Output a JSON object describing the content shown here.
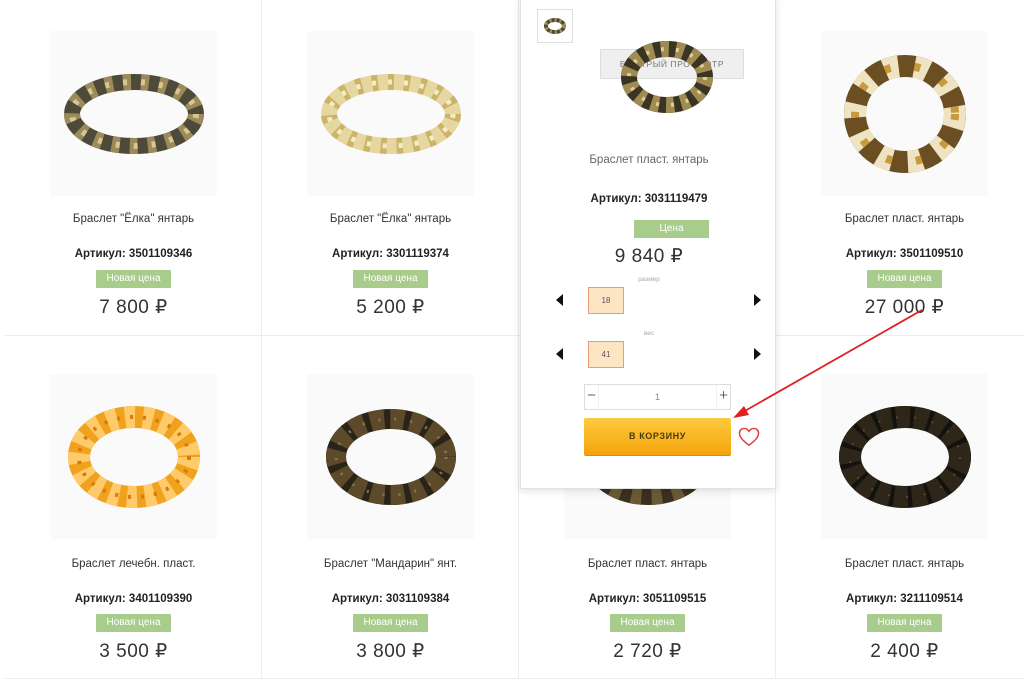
{
  "products": [
    {
      "name": "Браслет \"Ёлка\" янтарь",
      "sku": "Артикул: 3501109346",
      "badge": "Новая цена",
      "price": "7 800 ₽",
      "style": "dark-mix"
    },
    {
      "name": "Браслет \"Ёлка\" янтарь",
      "sku": "Артикул: 3301119374",
      "badge": "Новая цена",
      "price": "5 200 ₽",
      "style": "light"
    },
    {
      "name": "Браслет пласт. янтарь",
      "sku": "Артикул: 3031119479",
      "badge": "Цена",
      "price": "9 840 ₽",
      "style": "dark-mix"
    },
    {
      "name": "Браслет пласт. янтарь",
      "sku": "Артикул: 3501109510",
      "badge": "Новая цена",
      "price": "27 000 ₽",
      "style": "mixed"
    },
    {
      "name": "Браслет лечебн. пласт.",
      "sku": "Артикул: 3401109390",
      "badge": "Новая цена",
      "price": "3 500 ₽",
      "style": "orange"
    },
    {
      "name": "Браслет \"Мандарин\" янт.",
      "sku": "Артикул: 3031109384",
      "badge": "Новая цена",
      "price": "3 800 ₽",
      "style": "dark"
    },
    {
      "name": "Браслет пласт. янтарь",
      "sku": "Артикул: 3051109515",
      "badge": "Новая цена",
      "price": "2 720 ₽",
      "style": "dark"
    },
    {
      "name": "Браслет пласт. янтарь",
      "sku": "Артикул: 3211109514",
      "badge": "Новая цена",
      "price": "2 400 ₽",
      "style": "black"
    }
  ],
  "quickview": {
    "button_label": "БЫСТРЫЙ ПРОСМОТР",
    "name": "Браслет пласт. янтарь",
    "sku": "Артикул: 3031119479",
    "badge": "Цена",
    "price": "9 840 ₽",
    "size_label": "размер",
    "size_value": "18",
    "weight_label": "вес",
    "weight_value": "41",
    "qty_minus": "−",
    "qty_value": "1",
    "qty_plus": "+",
    "cart_label": "В КОРЗИНУ",
    "heart_icon": "heart-outline-icon"
  },
  "colors": {
    "badge": "#a8cc8c",
    "cart_gradient_top": "#fdcb3f",
    "cart_gradient_bottom": "#f4a30b",
    "heart": "#e0393e",
    "annotation_arrow": "#e02020",
    "option_border": "#e89a7a",
    "option_fill": "#fde5c4"
  }
}
